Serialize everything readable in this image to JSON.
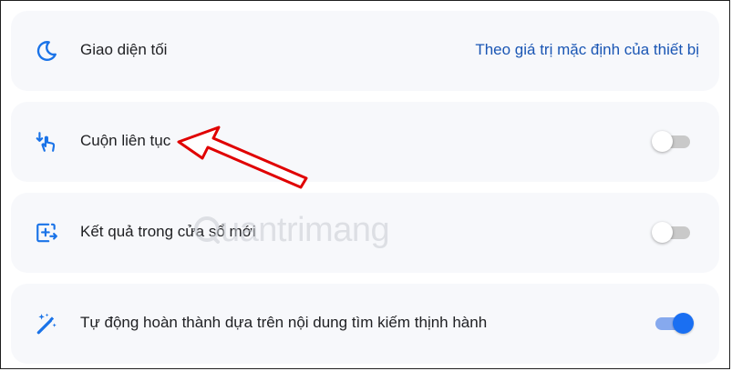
{
  "settings": {
    "dark_mode": {
      "icon": "moon-icon",
      "label": "Giao diện tối",
      "value": "Theo giá trị mặc định của thiết bị"
    },
    "continuous_scroll": {
      "icon": "scroll-hand-icon",
      "label": "Cuộn liên tục",
      "enabled": false
    },
    "open_new_window": {
      "icon": "open-in-new-window-icon",
      "label": "Kết quả trong cửa sổ mới",
      "enabled": false
    },
    "autocomplete": {
      "icon": "magic-wand-icon",
      "label": "Tự động hoàn thành dựa trên nội dung tìm kiếm thịnh hành",
      "enabled": true
    }
  },
  "watermark": "uantrimang",
  "colors": {
    "accent": "#1a6ff2",
    "link": "#1a56b4",
    "card_background": "#f7f8fb",
    "annotation_arrow": "#e00000"
  }
}
